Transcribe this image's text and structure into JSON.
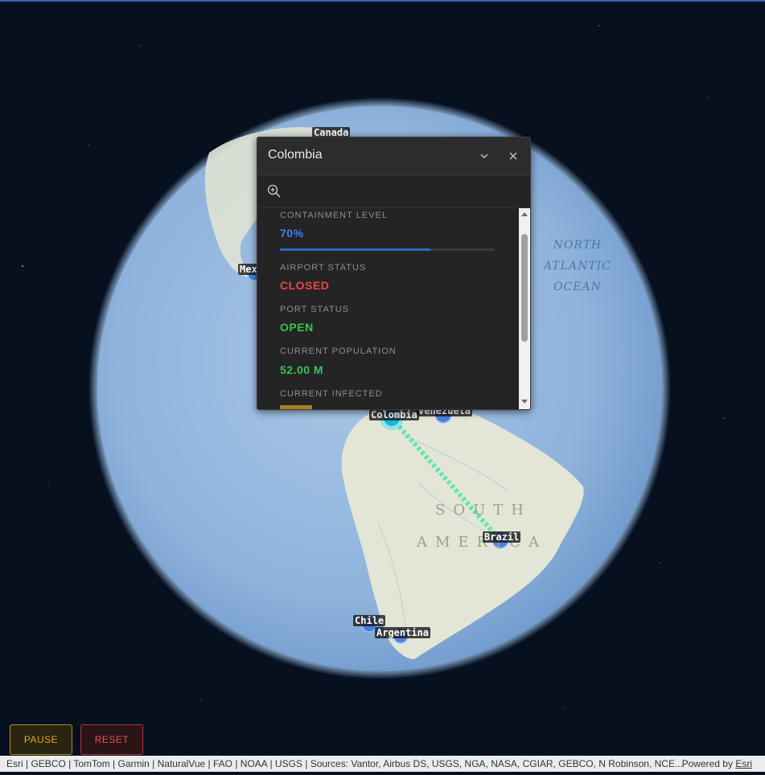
{
  "map": {
    "labels": {
      "canada": "Canada",
      "mexico": "Mex",
      "colombia": "Colombia",
      "venezuela": "Venezuela",
      "brazil": "Brazil",
      "chile": "Chile",
      "argentina": "Argentina"
    },
    "ocean": [
      "NORTH",
      "ATLANTIC",
      "OCEAN"
    ],
    "continent": [
      "SOUTH",
      "AMERICA"
    ],
    "colors": {
      "route": "#4fe8b0",
      "marker": "#3a78e0",
      "selected_marker": "#1fd0f0"
    }
  },
  "popup": {
    "title": "Colombia",
    "collapse_icon": "chevron-down-icon",
    "close_icon": "close-icon",
    "zoom_icon": "zoom-in-icon",
    "fields": {
      "containment_label": "CONTAINMENT LEVEL",
      "containment_value": "70%",
      "containment_fraction": 0.7,
      "airport_label": "AIRPORT STATUS",
      "airport_value": "CLOSED",
      "port_label": "PORT STATUS",
      "port_value": "OPEN",
      "population_label": "CURRENT POPULATION",
      "population_value": "52.00 M",
      "infected_label": "CURRENT INFECTED"
    },
    "colors": {
      "containment": "#3b82f6",
      "closed": "#e5484d",
      "open": "#30c45a",
      "population": "#30c45a",
      "infected": "#e0a824"
    }
  },
  "controls": {
    "pause_label": "PAUSE",
    "reset_label": "RESET"
  },
  "attribution": {
    "sources": "Esri | GEBCO | TomTom | Garmin | NaturalVue | FAO | NOAA | USGS | Sources: Vantor, Airbus DS, USGS, NGA, NASA, CGIAR, GEBCO, N Robinson, NCE...",
    "powered_by": "Powered by",
    "powered_link": "Esri"
  }
}
